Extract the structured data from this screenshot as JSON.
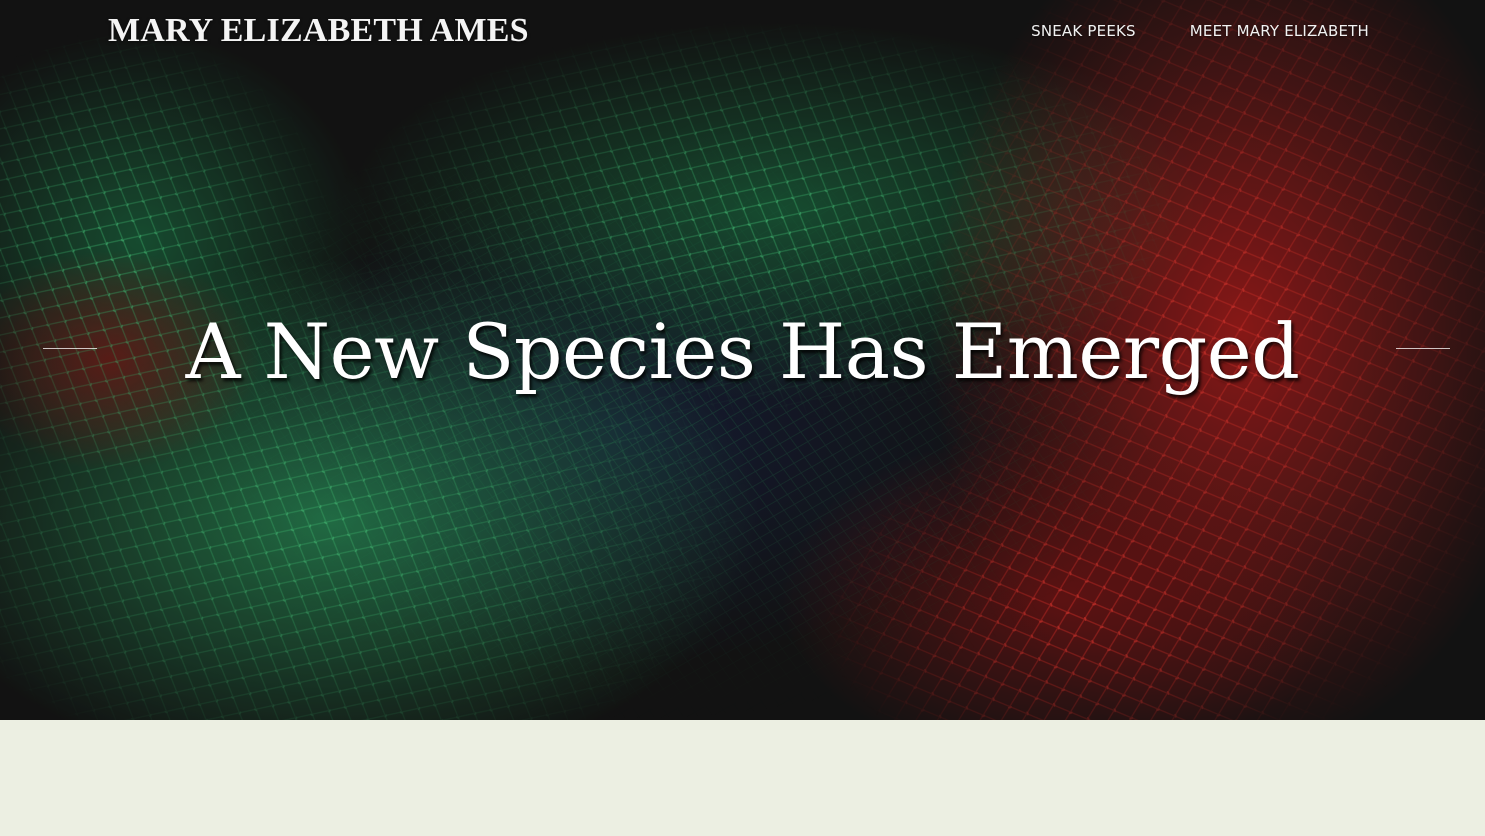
{
  "header": {
    "site_title": "MARY ELIZABETH AMES",
    "nav": [
      {
        "label": "SNEAK PEEKS"
      },
      {
        "label": "MEET MARY ELIZABETH"
      }
    ]
  },
  "hero": {
    "heading": "A New Species Has Emerged",
    "background_image": "green-and-red-net-mesh"
  },
  "colors": {
    "hero_dark": "#191919",
    "net_green": "#2fa564",
    "net_red": "#c8201e",
    "page_background": "#ecefe2",
    "text_light": "#ffffff"
  }
}
